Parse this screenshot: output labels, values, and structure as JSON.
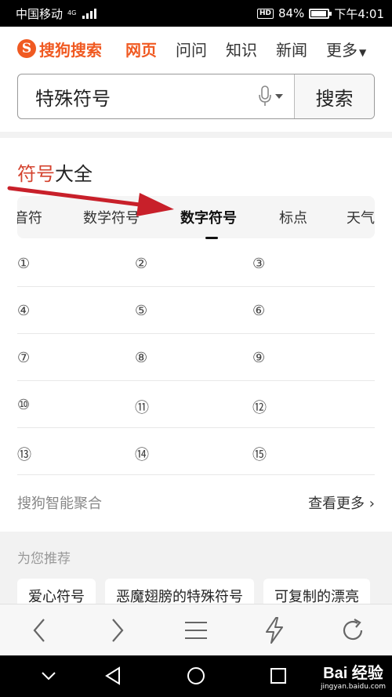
{
  "status_bar": {
    "carrier": "中国移动",
    "network": "4G",
    "battery": "84%",
    "battery_level": 0.84,
    "time": "下午4:01"
  },
  "top_nav": {
    "logo_text": "搜狗搜索",
    "tabs": [
      {
        "label": "网页",
        "active": true
      },
      {
        "label": "问问",
        "active": false
      },
      {
        "label": "知识",
        "active": false
      },
      {
        "label": "新闻",
        "active": false
      },
      {
        "label": "更多",
        "active": false
      }
    ]
  },
  "search": {
    "query": "特殊符号",
    "button_label": "搜索"
  },
  "card": {
    "title_highlight": "符号",
    "title_rest": "大全",
    "symbol_tabs": [
      {
        "label": "音符",
        "active": false
      },
      {
        "label": "数学符号",
        "active": false
      },
      {
        "label": "数字符号",
        "active": true
      },
      {
        "label": "标点",
        "active": false
      },
      {
        "label": "天气",
        "active": false
      }
    ],
    "symbols": [
      [
        "①",
        "②",
        "③"
      ],
      [
        "④",
        "⑤",
        "⑥"
      ],
      [
        "⑦",
        "⑧",
        "⑨"
      ],
      [
        "⑩",
        "⑪",
        "⑫"
      ],
      [
        "⑬",
        "⑭",
        "⑮"
      ]
    ],
    "source": "搜狗智能聚合",
    "more": "查看更多"
  },
  "recommend": {
    "title": "为您推荐",
    "chips": [
      "爱心符号",
      "恶魔翅膀的特殊符号",
      "可复制的漂亮"
    ]
  },
  "toolbar": {
    "icons": [
      "back-icon",
      "forward-icon",
      "menu-icon",
      "lightning-icon",
      "refresh-icon"
    ]
  },
  "watermark": {
    "line1": "Bai 经验",
    "line2": "jingyan.baidu.com"
  },
  "colors": {
    "accent": "#f05a22",
    "title_red": "#d4422e",
    "annotation_arrow": "#c8202a"
  }
}
